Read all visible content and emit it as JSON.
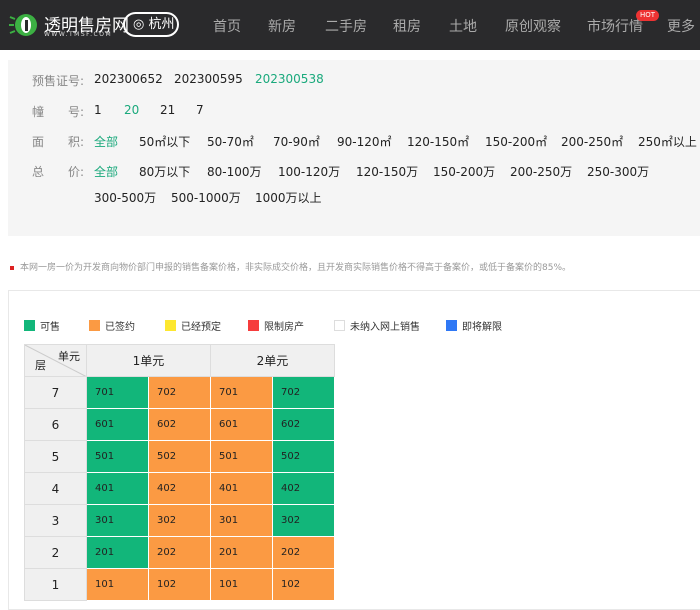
{
  "nav": {
    "brand": "透明售房网",
    "brand_sub": "WWW.TMSF.COM",
    "city": "杭州",
    "items": [
      "首页",
      "新房",
      "二手房",
      "租房",
      "土地",
      "原创观察",
      "市场行情",
      "更多"
    ],
    "hot_badge": "HOT"
  },
  "filters": {
    "presale": {
      "label": "预售证号:",
      "options": [
        "202300652",
        "202300595",
        "202300538"
      ],
      "selected": 2
    },
    "building": {
      "label": "幢　　号:",
      "options": [
        "1",
        "20",
        "21",
        "7"
      ],
      "selected": 1
    },
    "area": {
      "label": "面　　积:",
      "options": [
        "全部",
        "50㎡以下",
        "50-70㎡",
        "70-90㎡",
        "90-120㎡",
        "120-150㎡",
        "150-200㎡",
        "200-250㎡",
        "250㎡以上"
      ],
      "selected": 0
    },
    "price": {
      "label": "总　　价:",
      "options": [
        "全部",
        "80万以下",
        "80-100万",
        "100-120万",
        "120-150万",
        "150-200万",
        "200-250万",
        "250-300万",
        "300-500万",
        "500-1000万",
        "1000万以上"
      ],
      "selected": 0
    }
  },
  "notice": "本网一房一价为开发商向物价部门申报的销售备案价格，非实际成交价格，且开发商实际销售价格不得高于备案价，或低于备案价的85%。",
  "legend": [
    {
      "label": "可售",
      "color": "#12b67a"
    },
    {
      "label": "已签约",
      "color": "#fb9a43"
    },
    {
      "label": "已经预定",
      "color": "#fde72f"
    },
    {
      "label": "限制房产",
      "color": "#f63c3c"
    },
    {
      "label": "未纳入网上销售",
      "color": "#ffffff"
    },
    {
      "label": "即将解限",
      "color": "#2f78f5"
    }
  ],
  "table": {
    "corner_unit": "单元",
    "corner_floor": "层",
    "units": [
      "1单元",
      "2单元"
    ],
    "rows": [
      {
        "floor": "7",
        "rooms": [
          [
            "701",
            "g"
          ],
          [
            "702",
            "o"
          ],
          [
            "701",
            "o"
          ],
          [
            "702",
            "g"
          ]
        ]
      },
      {
        "floor": "6",
        "rooms": [
          [
            "601",
            "g"
          ],
          [
            "602",
            "o"
          ],
          [
            "601",
            "o"
          ],
          [
            "602",
            "g"
          ]
        ]
      },
      {
        "floor": "5",
        "rooms": [
          [
            "501",
            "g"
          ],
          [
            "502",
            "o"
          ],
          [
            "501",
            "o"
          ],
          [
            "502",
            "g"
          ]
        ]
      },
      {
        "floor": "4",
        "rooms": [
          [
            "401",
            "g"
          ],
          [
            "402",
            "o"
          ],
          [
            "401",
            "o"
          ],
          [
            "402",
            "g"
          ]
        ]
      },
      {
        "floor": "3",
        "rooms": [
          [
            "301",
            "g"
          ],
          [
            "302",
            "o"
          ],
          [
            "301",
            "o"
          ],
          [
            "302",
            "g"
          ]
        ]
      },
      {
        "floor": "2",
        "rooms": [
          [
            "201",
            "g"
          ],
          [
            "202",
            "o"
          ],
          [
            "201",
            "o"
          ],
          [
            "202",
            "o"
          ]
        ]
      },
      {
        "floor": "1",
        "rooms": [
          [
            "101",
            "o"
          ],
          [
            "102",
            "o"
          ],
          [
            "101",
            "o"
          ],
          [
            "102",
            "o"
          ]
        ]
      }
    ]
  }
}
